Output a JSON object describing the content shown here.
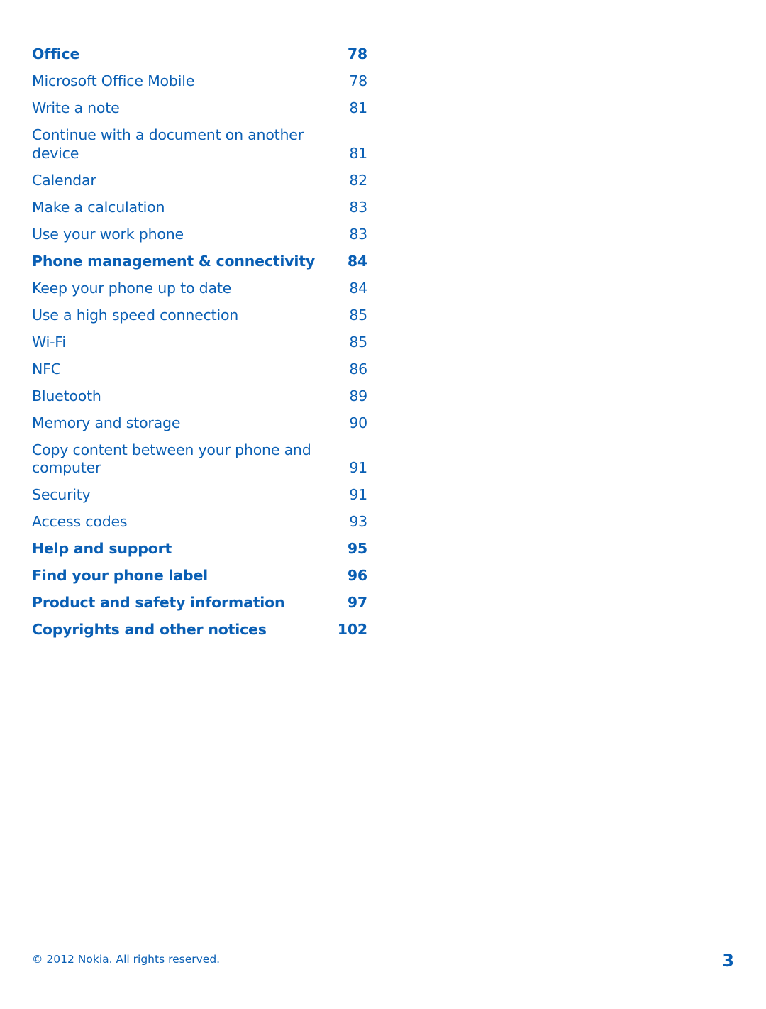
{
  "toc": [
    {
      "title": "Office",
      "page": "78",
      "bold": true
    },
    {
      "title": "Microsoft Office Mobile",
      "page": "78",
      "bold": false
    },
    {
      "title": "Write a note",
      "page": "81",
      "bold": false
    },
    {
      "title": "Continue with a document on another device",
      "page": "81",
      "bold": false
    },
    {
      "title": "Calendar",
      "page": "82",
      "bold": false
    },
    {
      "title": "Make a calculation",
      "page": "83",
      "bold": false
    },
    {
      "title": "Use your work phone",
      "page": "83",
      "bold": false
    },
    {
      "title": "Phone management & connectivity",
      "page": "84",
      "bold": true
    },
    {
      "title": "Keep your phone up to date",
      "page": "84",
      "bold": false
    },
    {
      "title": "Use a high speed connection",
      "page": "85",
      "bold": false
    },
    {
      "title": "Wi-Fi",
      "page": "85",
      "bold": false
    },
    {
      "title": "NFC",
      "page": "86",
      "bold": false
    },
    {
      "title": "Bluetooth",
      "page": "89",
      "bold": false
    },
    {
      "title": "Memory and storage",
      "page": "90",
      "bold": false
    },
    {
      "title": "Copy content between your phone and computer",
      "page": "91",
      "bold": false
    },
    {
      "title": "Security",
      "page": "91",
      "bold": false
    },
    {
      "title": "Access codes",
      "page": "93",
      "bold": false
    },
    {
      "title": "Help and support",
      "page": "95",
      "bold": true
    },
    {
      "title": "Find your phone label",
      "page": "96",
      "bold": true
    },
    {
      "title": "Product and safety information",
      "page": "97",
      "bold": true
    },
    {
      "title": "Copyrights and other notices",
      "page": "102",
      "bold": true
    }
  ],
  "footer": {
    "copyright": "© 2012 Nokia. All rights reserved.",
    "page_number": "3"
  },
  "colors": {
    "text": "#0a5fb4",
    "background": "#ffffff"
  }
}
